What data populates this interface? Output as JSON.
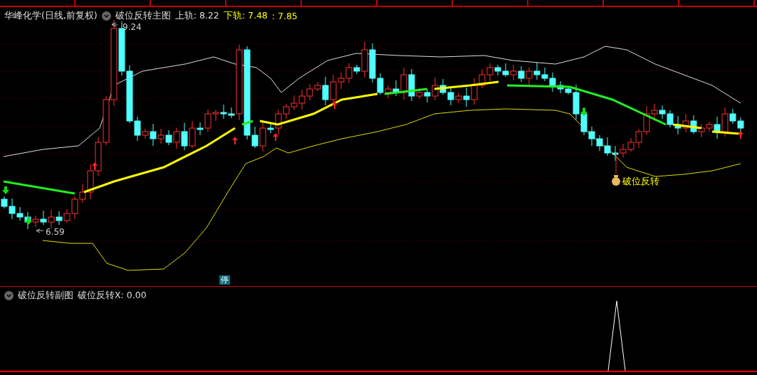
{
  "chart_header": {
    "stock_title": "华峰化学(日线,前复权)",
    "indicator": "破位反转主图",
    "upper_band": "上轨: 8.22",
    "lower_band": "下轨: 7.48",
    "extra_value": ": 7.85"
  },
  "price_labels": [
    {
      "text": "9.24"
    },
    {
      "text": "6.59"
    }
  ],
  "signal_label": "破位反转",
  "halt_badge": "停",
  "sub_chart_header": {
    "indicator": "破位反转副图",
    "value": "破位反转X: 0.00"
  }
}
